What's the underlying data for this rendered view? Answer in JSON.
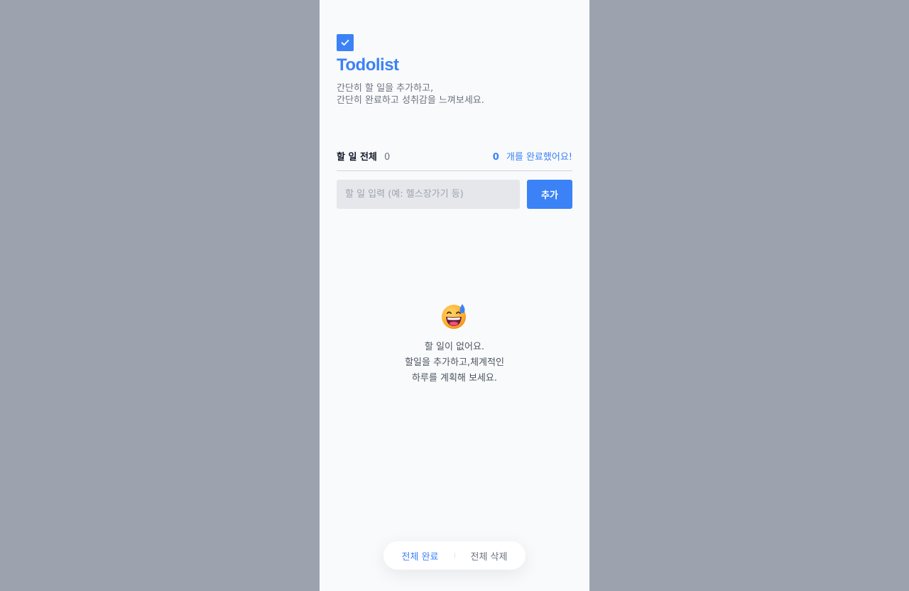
{
  "app": {
    "title": "Todolist",
    "subtitle_line1": "간단히 할 일을 추가하고,",
    "subtitle_line2": "간단히 완료하고 성취감을 느껴보세요.",
    "logo_icon": "checkbox-check-icon",
    "accent_color": "#3b82f6"
  },
  "summary": {
    "total_label": "할 일 전체",
    "total_count": "0",
    "done_count": "0",
    "done_suffix": "개를 완료했어요!"
  },
  "input": {
    "value": "",
    "placeholder": "할 일 입력 (예: 헬스장가기 등)"
  },
  "add_button_label": "추가",
  "empty": {
    "icon": "grinning-sweat-emoji-icon",
    "line1": "할 일이 없어요.",
    "line2": "할일을 추가하고,체계적인",
    "line3": "하루를 계획해 보세요."
  },
  "bottom_bar": {
    "complete_all_label": "전체 완료",
    "delete_all_label": "전체 삭제"
  }
}
